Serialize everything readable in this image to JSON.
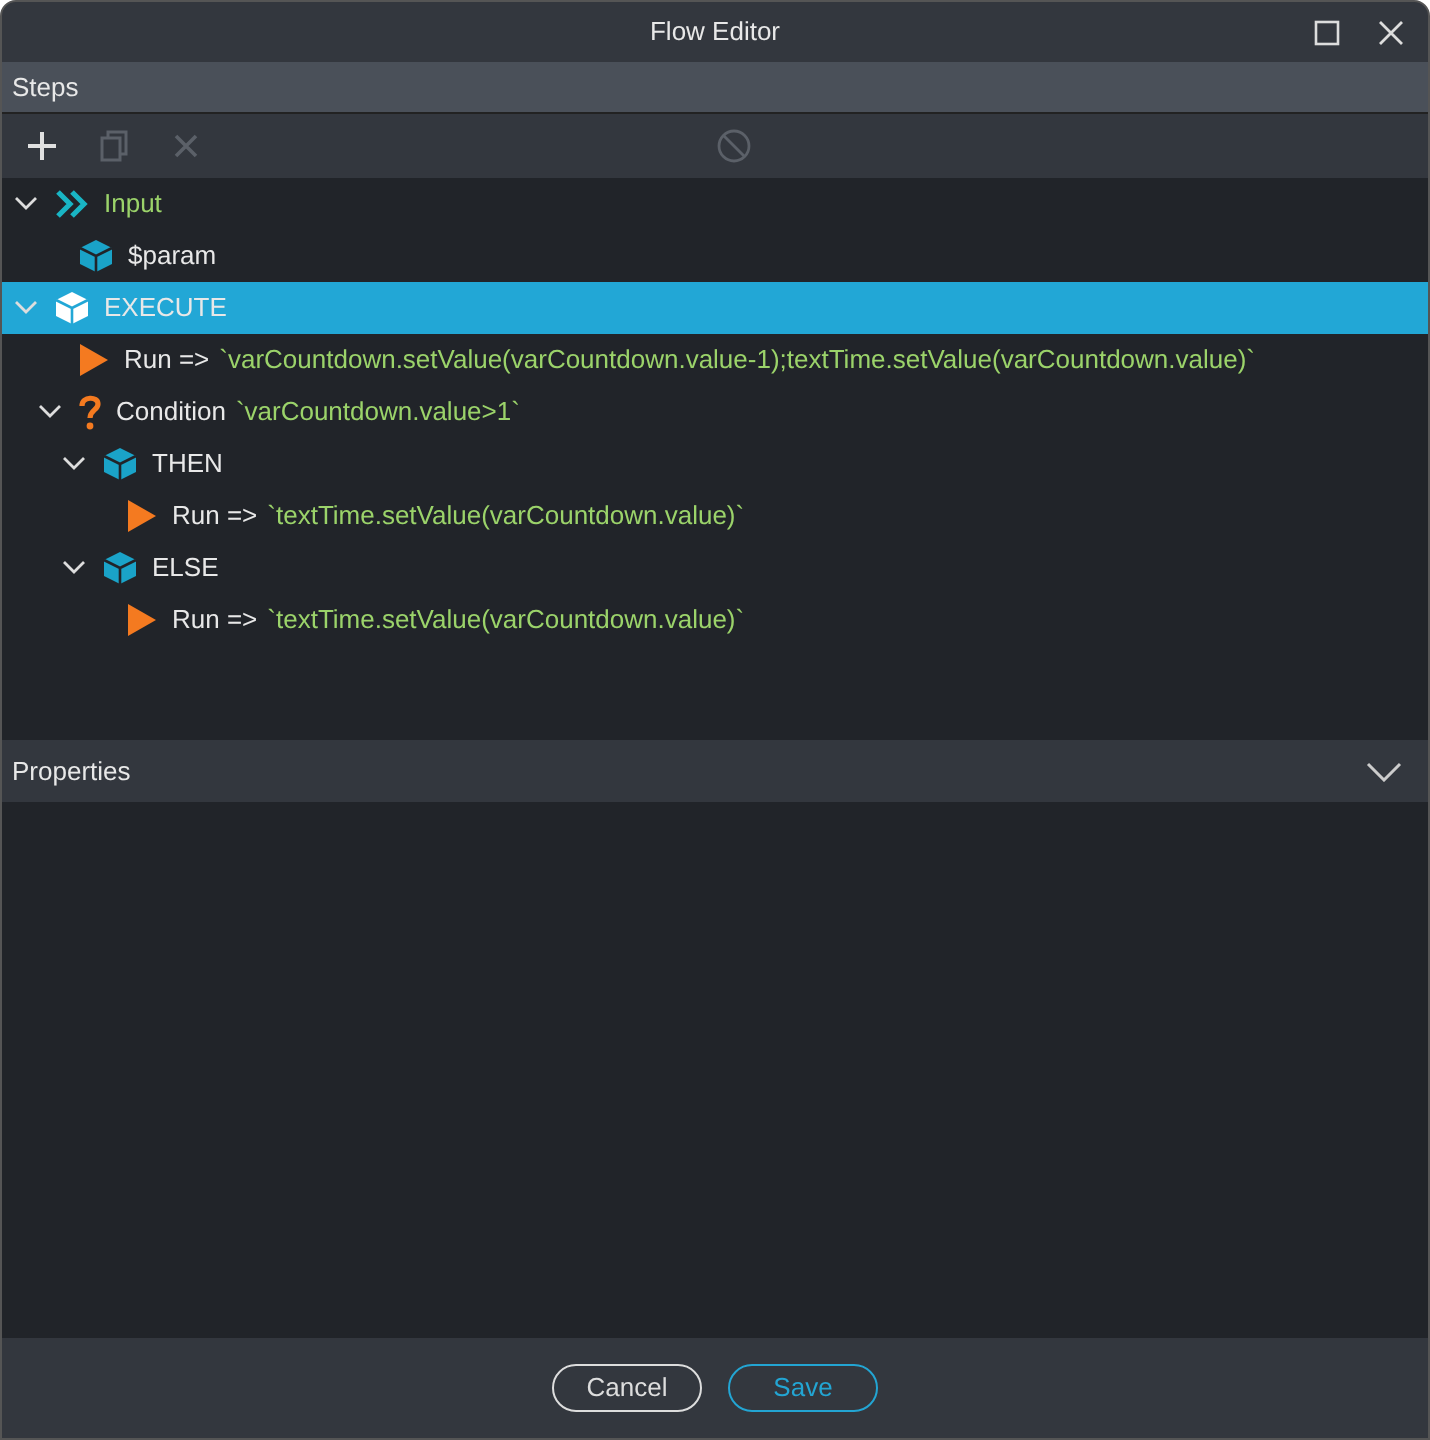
{
  "window": {
    "title": "Flow Editor"
  },
  "steps": {
    "title": "Steps",
    "toolbar": [
      {
        "kind": "add",
        "disabled": false
      },
      {
        "kind": "copy",
        "disabled": true
      },
      {
        "kind": "delete",
        "disabled": true
      },
      {
        "kind": "disable",
        "disabled": true
      }
    ],
    "tree": [
      {
        "kind": "input",
        "label": "Input",
        "expanded": true,
        "selected": false,
        "children": [
          {
            "kind": "box",
            "label": "$param",
            "selected": false
          }
        ]
      },
      {
        "kind": "box",
        "label": "EXECUTE",
        "expanded": true,
        "selected": true,
        "children": [
          {
            "kind": "run",
            "label": "Run =>",
            "code": "`varCountdown.setValue(varCountdown.value-1);textTime.setValue(varCountdown.value)`",
            "selected": false
          },
          {
            "kind": "condition",
            "label": "Condition",
            "code": "`varCountdown.value>1`",
            "expanded": true,
            "selected": false,
            "children": [
              {
                "kind": "box",
                "label": "THEN",
                "expanded": true,
                "selected": false,
                "children": [
                  {
                    "kind": "run",
                    "label": "Run =>",
                    "code": "`textTime.setValue(varCountdown.value)`",
                    "selected": false
                  }
                ]
              },
              {
                "kind": "box",
                "label": "ELSE",
                "expanded": true,
                "selected": false,
                "children": [
                  {
                    "kind": "run",
                    "label": "Run =>",
                    "code": "`textTime.setValue(varCountdown.value)`",
                    "selected": false
                  }
                ]
              }
            ]
          }
        ]
      }
    ]
  },
  "properties": {
    "title": "Properties"
  },
  "buttons": [
    {
      "label": "Cancel",
      "kind": "secondary"
    },
    {
      "label": "Save",
      "kind": "primary"
    }
  ]
}
